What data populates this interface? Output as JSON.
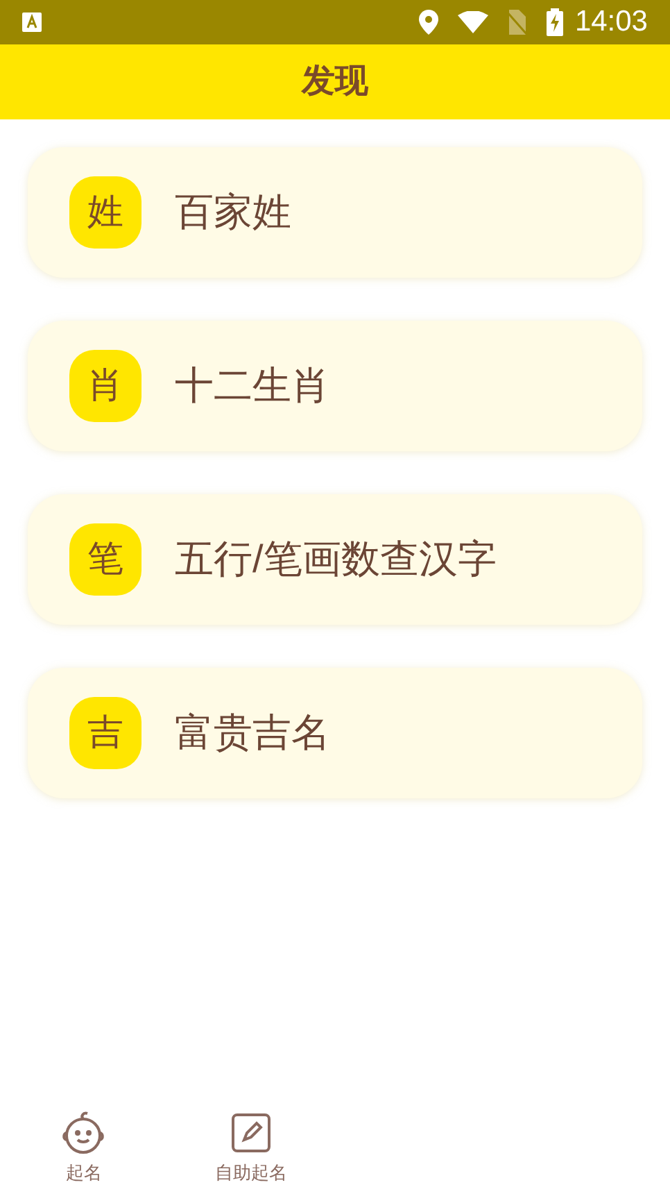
{
  "status_bar": {
    "time": "14:03"
  },
  "header": {
    "title": "发现"
  },
  "items": [
    {
      "badge": "姓",
      "label": "百家姓"
    },
    {
      "badge": "肖",
      "label": "十二生肖"
    },
    {
      "badge": "笔",
      "label": "五行/笔画数查汉字"
    },
    {
      "badge": "吉",
      "label": "富贵吉名"
    }
  ],
  "bottom_nav": [
    {
      "kind": "baby",
      "label": "起名",
      "selected": false
    },
    {
      "kind": "pen",
      "label": "自助起名",
      "selected": false
    }
  ]
}
